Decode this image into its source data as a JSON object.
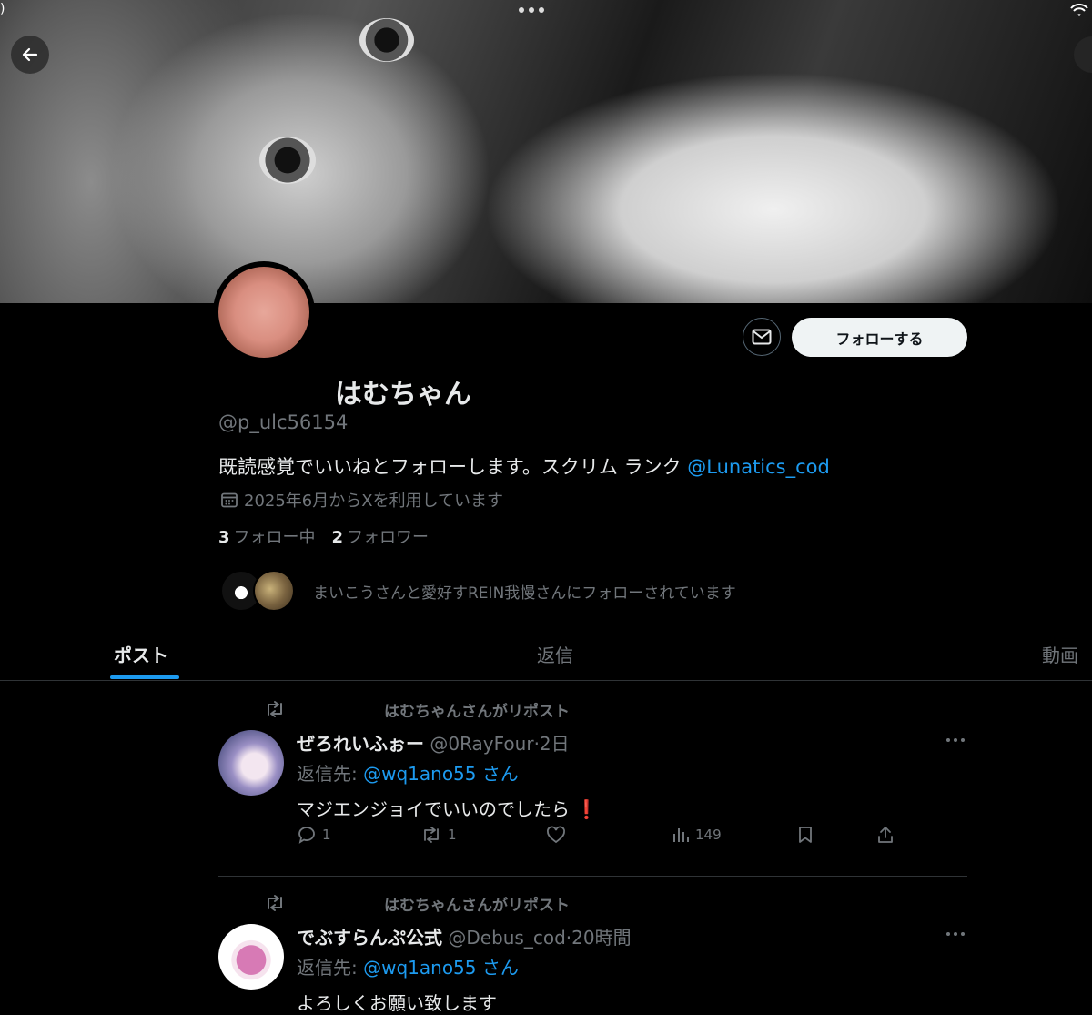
{
  "status": {
    "left_glyph": ")"
  },
  "profile": {
    "display_name": "はむちゃん",
    "handle": "@p_ulc56154",
    "bio_text": "既読感覚でいいねとフォローします。スクリム ランク ",
    "bio_link": "@Lunatics_cod",
    "joined": "2025年6月からXを利用しています",
    "following_count": "3",
    "following_label": "フォロー中",
    "followers_count": "2",
    "followers_label": "フォロワー",
    "followed_by": "まいこうさんと愛好すREIN我慢さんにフォローされています",
    "follow_button": "フォローする"
  },
  "tabs": [
    {
      "label": "ポスト",
      "active": true
    },
    {
      "label": "返信",
      "active": false
    },
    {
      "label": "動画",
      "active": false
    }
  ],
  "posts": [
    {
      "repost_label": "はむちゃんさんがリポスト",
      "name": "ぜろれいふぉー",
      "handle": "@0RayFour",
      "time": "2日",
      "reply_prefix": "返信先: ",
      "reply_to": "@wq1ano55 さん",
      "text": "マジエンジョイでいいのでしたら",
      "emoji": "❗",
      "replies": "1",
      "reposts": "1",
      "views": "149"
    },
    {
      "repost_label": "はむちゃんさんがリポスト",
      "name": "でぶすらんぷ公式",
      "handle": "@Debus_cod",
      "time": "20時間",
      "reply_prefix": "返信先: ",
      "reply_to": "@wq1ano55 さん",
      "text": "よろしくお願い致します"
    }
  ],
  "colors": {
    "accent": "#1d9bf0",
    "background": "#000000",
    "secondary_text": "#71767b"
  }
}
